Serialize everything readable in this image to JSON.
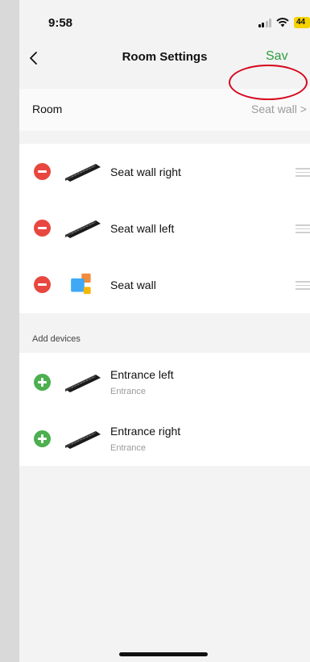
{
  "status_bar": {
    "time": "9:58",
    "battery": "44"
  },
  "nav": {
    "title": "Room Settings",
    "save_label": "Sav"
  },
  "room": {
    "label": "Room",
    "value": "Seat wall >"
  },
  "current_devices": [
    {
      "name": "Seat wall right",
      "icon": "led-bar-icon"
    },
    {
      "name": "Seat wall left",
      "icon": "led-bar-icon"
    },
    {
      "name": "Seat wall",
      "icon": "group-squares-icon"
    }
  ],
  "add_section_label": "Add devices",
  "add_devices": [
    {
      "name": "Entrance left",
      "room": "Entrance",
      "icon": "led-bar-icon"
    },
    {
      "name": "Entrance right",
      "room": "Entrance",
      "icon": "led-bar-icon"
    }
  ],
  "colors": {
    "accent_green": "#2e9e3e",
    "remove_red": "#e8473f",
    "add_green": "#4caf50",
    "highlight_ring": "#d6061b"
  }
}
